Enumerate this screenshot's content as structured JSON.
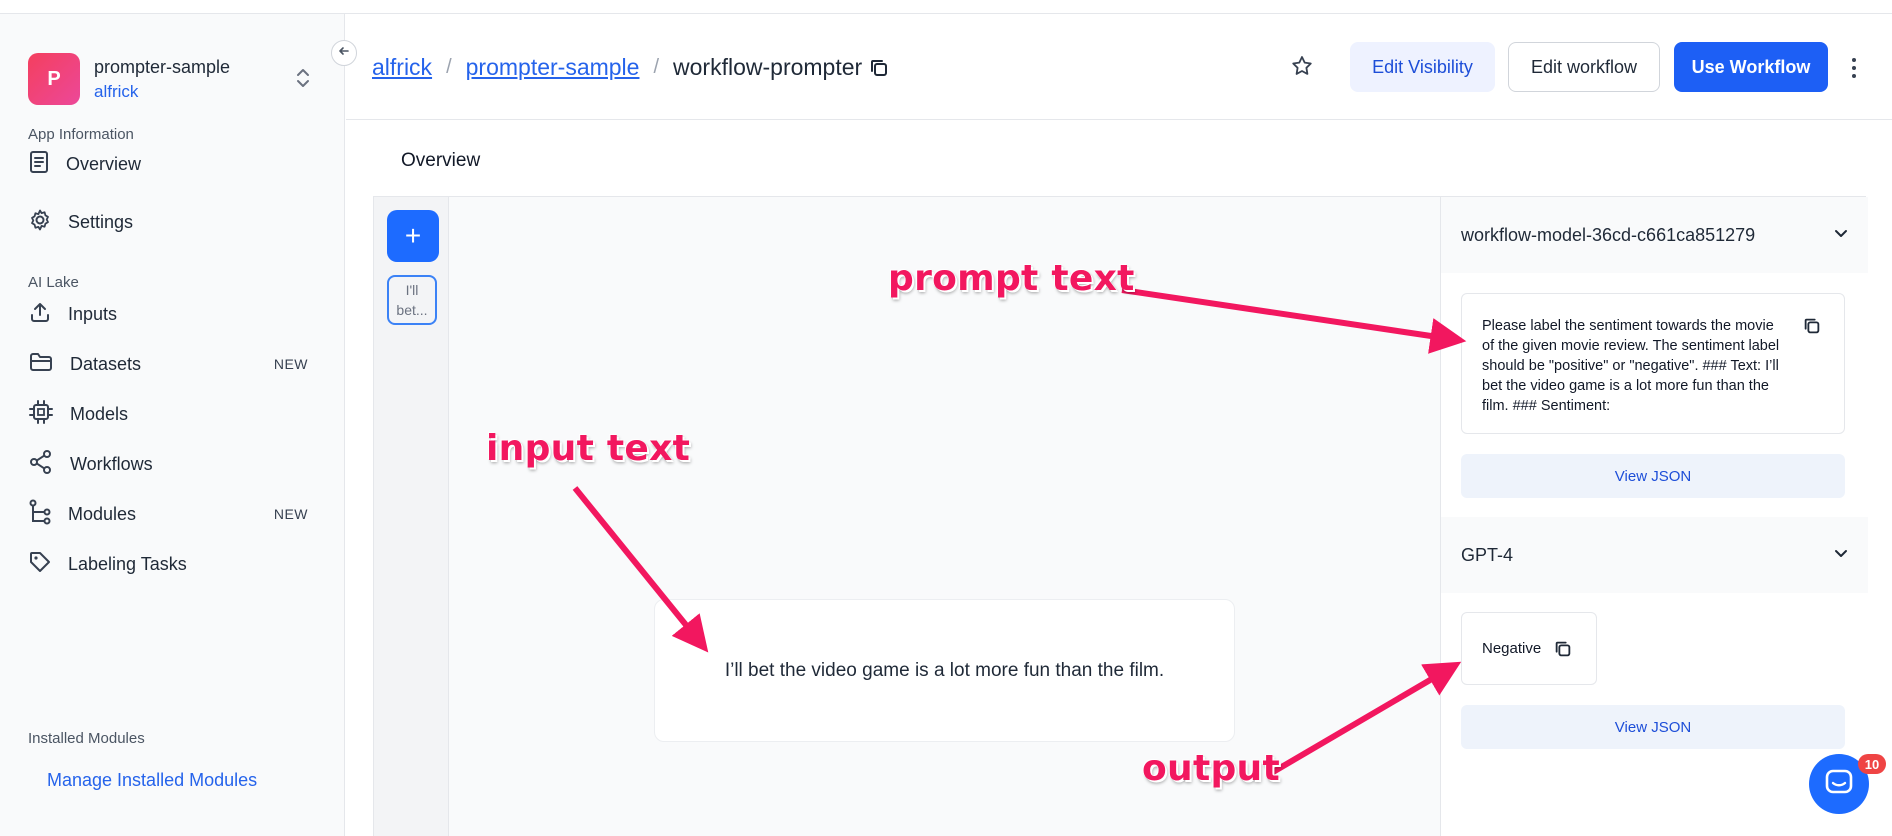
{
  "app": {
    "avatar_letter": "P",
    "name": "prompter-sample",
    "owner": "alfrick"
  },
  "sidebar": {
    "sections": {
      "app_info": "App Information",
      "ai_lake": "AI Lake",
      "installed": "Installed Modules"
    },
    "items": {
      "overview": "Overview",
      "settings": "Settings",
      "inputs": "Inputs",
      "datasets": "Datasets",
      "models": "Models",
      "workflows": "Workflows",
      "modules": "Modules",
      "labeling": "Labeling Tasks"
    },
    "badges": {
      "datasets": "NEW",
      "modules": "NEW"
    },
    "manage_link": "Manage Installed Modules"
  },
  "header": {
    "breadcrumb": [
      "alfrick",
      "prompter-sample",
      "workflow-prompter"
    ],
    "separator": "/",
    "edit_visibility": "Edit Visibility",
    "edit_workflow": "Edit workflow",
    "use_workflow": "Use Workflow"
  },
  "main": {
    "title": "Overview",
    "add_symbol": "+",
    "thumbnail_text": "I'll bet...",
    "input_text": "I’ll bet the video game is a lot more fun than the film."
  },
  "panel": {
    "model_node": "workflow-model-36cd-c661ca851279",
    "prompt_text": "Please label the sentiment towards the movie of the given movie review. The sentiment label should be \"positive\" or \"negative\". ### Text: I’ll bet the video game is a lot more fun than the film. ### Sentiment:",
    "view_json": "View JSON",
    "output_node": "GPT-4",
    "output_text": "Negative"
  },
  "annotations": {
    "prompt": "prompt text",
    "input": "input text",
    "output": "output"
  },
  "chat": {
    "badge_count": "10"
  },
  "colors": {
    "accent": "#1d5ff5",
    "annotation": "#f2175f",
    "link": "#2563eb"
  },
  "icons": [
    "collapse-arrow-icon",
    "chevron-updown-icon",
    "document-icon",
    "gear-icon",
    "upload-icon",
    "folder-icon",
    "chip-icon",
    "share-nodes-icon",
    "branch-icon",
    "tag-icon",
    "copy-icon",
    "star-icon",
    "kebab-icon",
    "chevron-down-icon",
    "chat-icon"
  ]
}
